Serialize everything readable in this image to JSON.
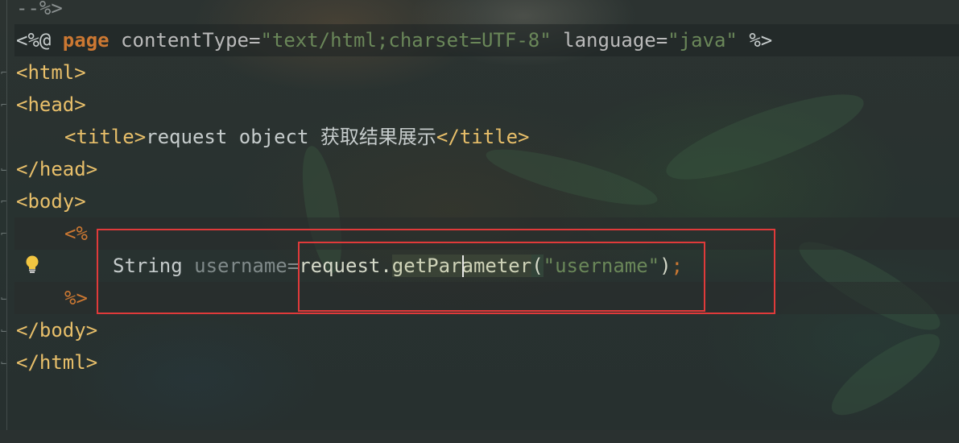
{
  "editor": {
    "lines": {
      "l0": {
        "text": "--%>"
      },
      "l1": {
        "open": "<%@ ",
        "kw": "page",
        "attr1": " contentType=",
        "val1": "\"text/html;charset=UTF-8\"",
        "attr2": " language=",
        "val2": "\"java\"",
        "close": " %>"
      },
      "l2": {
        "text": "<html>"
      },
      "l3": {
        "text": "<head>"
      },
      "l4": {
        "open": "<title>",
        "text": "request object 获取结果展示",
        "close": "</title>"
      },
      "l5": {
        "text": "</head>"
      },
      "l6": {
        "text": "<body>"
      },
      "l7": {
        "text": "<%"
      },
      "l8": {
        "type": "String",
        "var": " username",
        "eq": "=",
        "obj": "request.",
        "method": "getParameter",
        "lp": "(",
        "arg": "\"username\"",
        "rp": ")",
        "semi": ";"
      },
      "l9": {
        "text": "%>"
      },
      "l10": {
        "text": "</body>"
      },
      "l11": {
        "text": "</html>"
      }
    },
    "colors": {
      "tag": "#e8bf6a",
      "string": "#6a8759",
      "keyword": "#cc7832",
      "highlight_box": "#e03a3a"
    },
    "icons": {
      "intention": "lightbulb-icon"
    }
  }
}
